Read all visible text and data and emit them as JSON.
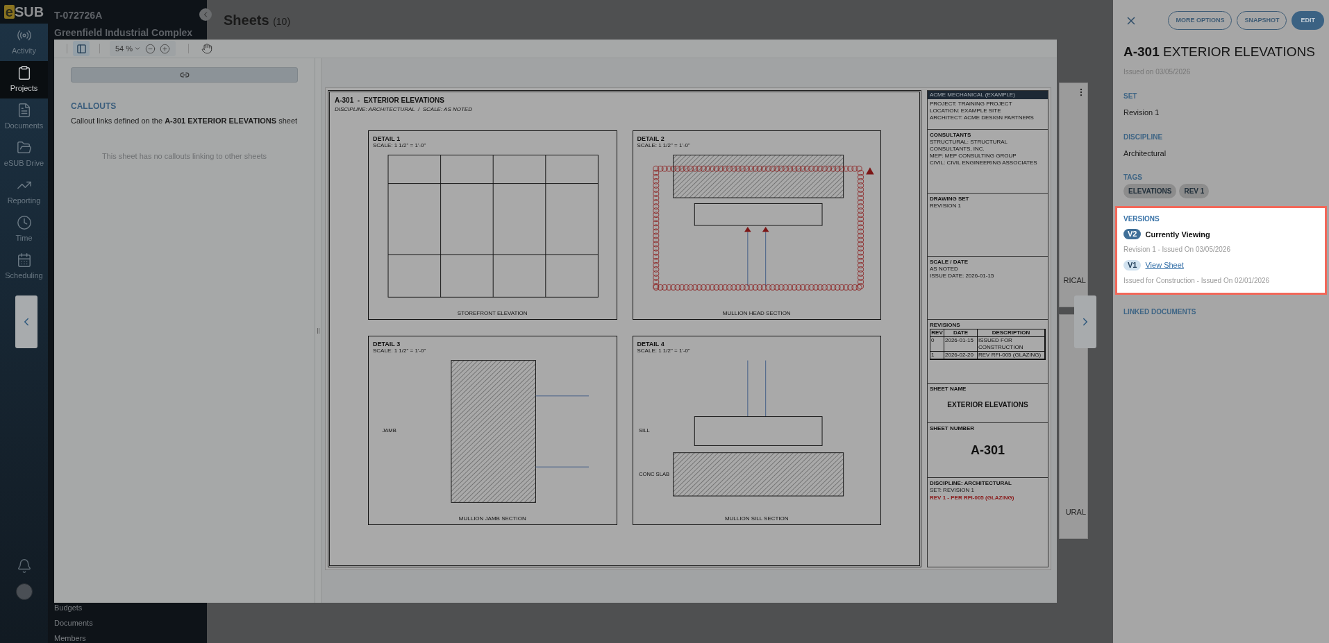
{
  "nav": {
    "logo": {
      "mark": "e",
      "text": "SUB"
    },
    "items": [
      {
        "label": "Activity",
        "selected": false
      },
      {
        "label": "Projects",
        "selected": true
      },
      {
        "label": "Documents",
        "selected": false
      },
      {
        "label": "eSUB Drive",
        "selected": false
      },
      {
        "label": "Reporting",
        "selected": false
      },
      {
        "label": "Time",
        "selected": false
      },
      {
        "label": "Scheduling",
        "selected": false
      }
    ]
  },
  "project": {
    "code": "T-072726A",
    "name": "Greenfield Industrial Complex",
    "menu_items": [
      "Budgets",
      "Documents",
      "Members"
    ]
  },
  "page": {
    "title": "Sheets",
    "count": "(10)",
    "card_labels": [
      "RICAL",
      "URAL"
    ]
  },
  "viewer": {
    "toolbar": {
      "zoom": "54 %",
      "sidebar_selected": true
    },
    "callouts": {
      "heading": "CALLOUTS",
      "description": "Callout links defined on the **A-301 EXTERIOR ELEVATIONS** sheet",
      "empty": "This sheet has no callouts linking to other sheets"
    },
    "sheet": {
      "title": "A-301  -  EXTERIOR ELEVATIONS",
      "subtitle": "DISCIPLINE: ARCHITECTURAL  /  SCALE: AS NOTED",
      "details": [
        {
          "kind": "grid",
          "title": "DETAIL 1",
          "scale": "SCALE: 1 1/2\" = 1'-0\"",
          "caption": "STOREFRONT ELEVATION"
        },
        {
          "kind": "head",
          "title": "DETAIL 2",
          "scale": "SCALE: 1 1/2\" = 1'-0\"",
          "caption": "MULLION HEAD SECTION"
        },
        {
          "kind": "jamb",
          "title": "DETAIL 3",
          "scale": "SCALE: 1 1/2\" = 1'-0\"",
          "caption": "MULLION JAMB SECTION",
          "labels": [
            "JAMB"
          ]
        },
        {
          "kind": "sill",
          "title": "DETAIL 4",
          "scale": "SCALE: 1 1/2\" = 1'-0\"",
          "caption": "MULLION SILL SECTION",
          "labels": [
            "SILL",
            "CONC SLAB"
          ]
        }
      ],
      "title_block": {
        "company": "ACME MECHANICAL (EXAMPLE)",
        "project_lines": [
          "PROJECT: TRAINING PROJECT",
          "LOCATION: EXAMPLE SITE",
          "ARCHITECT: ACME DESIGN PARTNERS"
        ],
        "sections": [
          {
            "heading": "CONSULTANTS",
            "lines": [
              "STRUCTURAL: STRUCTURAL CONSULTANTS, INC.",
              "MEP: MEP CONSULTING GROUP",
              "CIVIL: CIVIL ENGINEERING ASSOCIATES"
            ]
          },
          {
            "heading": "DRAWING SET",
            "lines": [
              "REVISION 1"
            ]
          },
          {
            "heading": "SCALE / DATE",
            "lines": [
              "AS NOTED",
              "ISSUE DATE: 2026-01-15"
            ]
          }
        ],
        "revisions": {
          "heading": "REVISIONS",
          "columns": [
            "REV",
            "DATE",
            "DESCRIPTION"
          ],
          "rows": [
            [
              "0",
              "2026-01-15",
              "ISSUED FOR CONSTRUCTION"
            ],
            [
              "1",
              "2026-02-20",
              "REV RFI-005 (GLAZING)"
            ]
          ]
        },
        "sheet_name": {
          "heading": "SHEET NAME",
          "value": "EXTERIOR ELEVATIONS"
        },
        "sheet_number": {
          "heading": "SHEET NUMBER",
          "value": "A-301"
        },
        "discipline": {
          "heading": "DISCIPLINE: ARCHITECTURAL",
          "line": "SET: REVISION 1",
          "note": "REV 1 - PER RFI-005 (GLAZING)"
        }
      }
    }
  },
  "details_panel": {
    "buttons": [
      {
        "label": "MORE OPTIONS",
        "kind": "outline"
      },
      {
        "label": "SNAPSHOT",
        "kind": "outline"
      },
      {
        "label": "EDIT",
        "kind": "filled"
      }
    ],
    "title_number": "A-301",
    "title_name": "EXTERIOR ELEVATIONS",
    "issued": "Issued on 03/05/2026",
    "fields": [
      {
        "label": "SET",
        "value": "Revision 1"
      },
      {
        "label": "DISCIPLINE",
        "value": "Architectural"
      }
    ],
    "tags_label": "TAGS",
    "tags": [
      "ELEVATIONS",
      "REV 1"
    ],
    "versions": {
      "heading": "VERSIONS",
      "items": [
        {
          "badge": "V2",
          "label": "Currently Viewing",
          "detail": "Revision 1 - Issued On 03/05/2026",
          "selected": true
        },
        {
          "badge": "V1",
          "label": "View Sheet",
          "detail": "Issued for Construction - Issued On 02/01/2026",
          "selected": false
        }
      ]
    },
    "linked_documents": "LINKED DOCUMENTS"
  }
}
